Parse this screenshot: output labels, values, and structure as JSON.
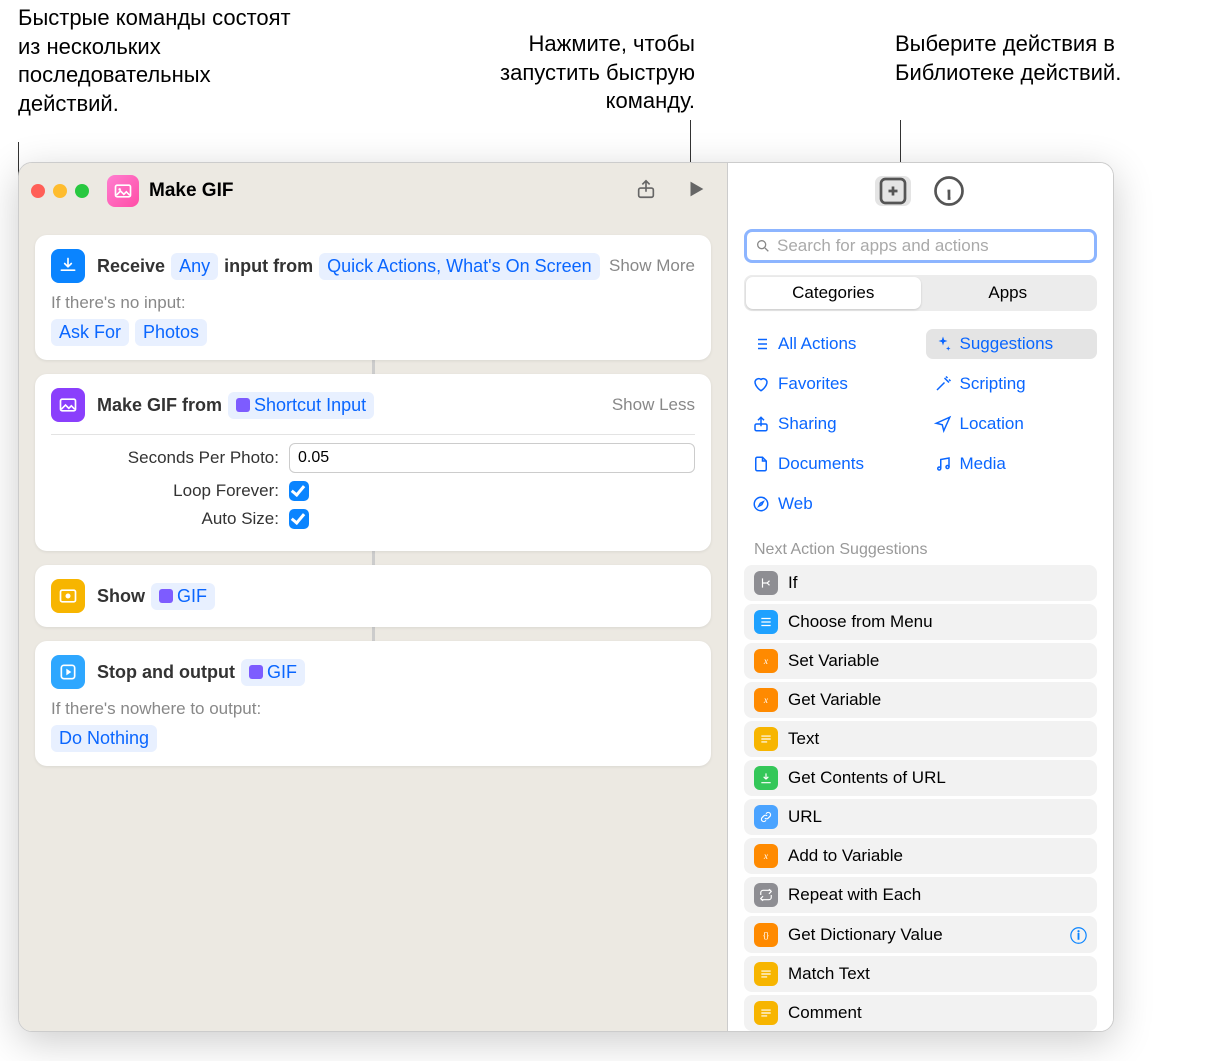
{
  "callouts": {
    "left": "Быстрые команды состоят из нескольких последовательных действий.",
    "middle": "Нажмите, чтобы запустить быструю команду.",
    "right": "Выберите действия в Библиотеке действий."
  },
  "window": {
    "title": "Make GIF",
    "cards": {
      "receive": {
        "verb": "Receive",
        "token_any": "Any",
        "connector": "input from",
        "token_sources": "Quick Actions, What's On Screen",
        "toggle": "Show More",
        "fallback_label": "If there's no input:",
        "token_askfor": "Ask For",
        "token_photos": "Photos"
      },
      "makegif": {
        "title": "Make GIF from",
        "token_input": "Shortcut Input",
        "toggle": "Show Less",
        "param1_label": "Seconds Per Photo:",
        "param1_value": "0.05",
        "param2_label": "Loop Forever:",
        "param3_label": "Auto Size:"
      },
      "show": {
        "title": "Show",
        "token_gif": "GIF"
      },
      "stop": {
        "title": "Stop and output",
        "token_gif": "GIF",
        "fallback_label": "If there's nowhere to output:",
        "token_donothing": "Do Nothing"
      }
    }
  },
  "sidebar": {
    "search_placeholder": "Search for apps and actions",
    "tabs": {
      "categories": "Categories",
      "apps": "Apps"
    },
    "categories": [
      {
        "label": "All Actions",
        "icon": "list"
      },
      {
        "label": "Suggestions",
        "icon": "sparkle",
        "selected": true
      },
      {
        "label": "Favorites",
        "icon": "heart"
      },
      {
        "label": "Scripting",
        "icon": "wand"
      },
      {
        "label": "Sharing",
        "icon": "share"
      },
      {
        "label": "Location",
        "icon": "nav"
      },
      {
        "label": "Documents",
        "icon": "doc"
      },
      {
        "label": "Media",
        "icon": "music"
      },
      {
        "label": "Web",
        "icon": "safari"
      }
    ],
    "suggestions_header": "Next Action Suggestions",
    "suggestions": [
      {
        "label": "If",
        "color": "si-gray",
        "glyph": "branch"
      },
      {
        "label": "Choose from Menu",
        "color": "si-blue",
        "glyph": "menu"
      },
      {
        "label": "Set Variable",
        "color": "si-orange",
        "glyph": "x"
      },
      {
        "label": "Get Variable",
        "color": "si-orange",
        "glyph": "x"
      },
      {
        "label": "Text",
        "color": "si-yellow",
        "glyph": "text"
      },
      {
        "label": "Get Contents of URL",
        "color": "si-green",
        "glyph": "dl"
      },
      {
        "label": "URL",
        "color": "si-lightblue",
        "glyph": "link"
      },
      {
        "label": "Add to Variable",
        "color": "si-orange",
        "glyph": "x"
      },
      {
        "label": "Repeat with Each",
        "color": "si-gray",
        "glyph": "repeat"
      },
      {
        "label": "Get Dictionary Value",
        "color": "si-orange",
        "glyph": "dict",
        "info": true
      },
      {
        "label": "Match Text",
        "color": "si-yellow",
        "glyph": "text"
      },
      {
        "label": "Comment",
        "color": "si-yellow",
        "glyph": "text"
      }
    ]
  }
}
